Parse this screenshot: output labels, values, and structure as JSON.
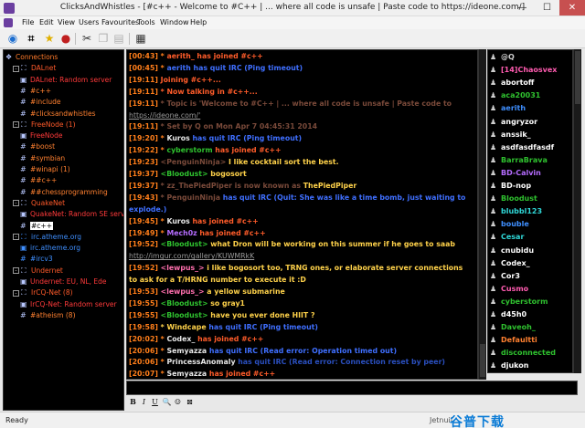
{
  "window": {
    "title": "ClicksAndWhistles - [#c++ - Welcome to #C++ | ... where all code is unsafe | Paste code to https://ideone.com/]",
    "controls": [
      "—",
      "☐",
      "✕"
    ]
  },
  "menu": [
    "File",
    "Edit",
    "View",
    "Users",
    "Favourites",
    "Tools",
    "Window",
    "Help"
  ],
  "toolbar_icons": [
    "globe-icon",
    "hash-icon",
    "star-icon",
    "ball-icon",
    "cut-icon",
    "copy-icon",
    "paste-icon",
    "clipboard-icon"
  ],
  "tree": [
    {
      "label": "Connections",
      "style": "t-conn",
      "indent": 0,
      "icon": "❖",
      "exp": null
    },
    {
      "label": "DALnet",
      "style": "t-net",
      "indent": 1,
      "icon": "⛶",
      "exp": "-"
    },
    {
      "label": "DALnet: Random server",
      "style": "t-server",
      "indent": 2,
      "icon": "▣",
      "exp": null
    },
    {
      "label": "#c++",
      "style": "t-chan",
      "indent": 2,
      "icon": "#",
      "exp": null
    },
    {
      "label": "#include",
      "style": "t-chan",
      "indent": 2,
      "icon": "#",
      "exp": null
    },
    {
      "label": "#clicksandwhistles",
      "style": "t-chan",
      "indent": 2,
      "icon": "#",
      "exp": null
    },
    {
      "label": "FreeNode (1)",
      "style": "t-net",
      "indent": 1,
      "icon": "⛶",
      "exp": "-"
    },
    {
      "label": "FreeNode",
      "style": "t-server",
      "indent": 2,
      "icon": "▣",
      "exp": null
    },
    {
      "label": "#boost",
      "style": "t-chan",
      "indent": 2,
      "icon": "#",
      "exp": null
    },
    {
      "label": "#symbian",
      "style": "t-chan",
      "indent": 2,
      "icon": "#",
      "exp": null
    },
    {
      "label": "#winapi (1)",
      "style": "t-chan",
      "indent": 2,
      "icon": "#",
      "exp": null
    },
    {
      "label": "##c++",
      "style": "t-chan",
      "indent": 2,
      "icon": "#",
      "exp": null
    },
    {
      "label": "##chessprogramming",
      "style": "t-chan",
      "indent": 2,
      "icon": "#",
      "exp": null
    },
    {
      "label": "QuakeNet",
      "style": "t-net",
      "indent": 1,
      "icon": "⛶",
      "exp": "-"
    },
    {
      "label": "QuakeNet: Random SE server",
      "style": "t-server",
      "indent": 2,
      "icon": "▣",
      "exp": null
    },
    {
      "label": "#c++",
      "style": "t-sel",
      "indent": 2,
      "icon": "#",
      "exp": null
    },
    {
      "label": "irc.atheme.org",
      "style": "t-blue",
      "indent": 1,
      "icon": "⛶",
      "exp": "-"
    },
    {
      "label": "irc.atheme.org",
      "style": "t-blue",
      "indent": 2,
      "icon": "▣",
      "exp": null
    },
    {
      "label": "#ircv3",
      "style": "t-blue",
      "indent": 2,
      "icon": "#",
      "exp": null
    },
    {
      "label": "Undernet",
      "style": "t-net",
      "indent": 1,
      "icon": "⛶",
      "exp": "-"
    },
    {
      "label": "Undernet: EU, NL, Ede",
      "style": "t-server",
      "indent": 2,
      "icon": "▣",
      "exp": null
    },
    {
      "label": "IrCQ-Net (8)",
      "style": "t-net",
      "indent": 1,
      "icon": "⛶",
      "exp": "-"
    },
    {
      "label": "IrCQ-Net: Random server",
      "style": "t-server",
      "indent": 2,
      "icon": "▣",
      "exp": null
    },
    {
      "label": "#atheism (8)",
      "style": "t-chan",
      "indent": 2,
      "icon": "#",
      "exp": null
    }
  ],
  "chat": [
    [
      {
        "t": "[00:43] ",
        "c": "c-time"
      },
      {
        "t": "* ",
        "c": "c-star"
      },
      {
        "t": "aerith_ has joined #c++",
        "c": "c-join"
      }
    ],
    [
      {
        "t": "[00:45] ",
        "c": "c-time"
      },
      {
        "t": "* ",
        "c": "c-star"
      },
      {
        "t": "aerith has quit IRC (Ping timeout)",
        "c": "c-part"
      }
    ],
    [
      {
        "t": "[19:11] ",
        "c": "c-time"
      },
      {
        "t": "Joining #c++...",
        "c": "c-join"
      }
    ],
    [
      {
        "t": "[19:11] ",
        "c": "c-time"
      },
      {
        "t": "* Now talking in #c++...",
        "c": "c-join"
      }
    ],
    [
      {
        "t": "[19:11] ",
        "c": "c-time"
      },
      {
        "t": "* Topic is 'Welcome to #C++ | ... where all code is unsafe | Paste code to",
        "c": "c-topicdim"
      }
    ],
    [
      {
        "t": "https://ideone.com/'",
        "c": "c-url"
      }
    ],
    [
      {
        "t": "[19:11] ",
        "c": "c-time"
      },
      {
        "t": "* Set by Q on Mon Apr 7 04:45:31 2014",
        "c": "c-topicdim"
      }
    ],
    [
      {
        "t": "[19:20] ",
        "c": "c-time"
      },
      {
        "t": "* ",
        "c": "c-star"
      },
      {
        "t": "Kuros ",
        "c": "c-white"
      },
      {
        "t": "has quit IRC (Ping timeout)",
        "c": "c-part"
      }
    ],
    [
      {
        "t": "[19:22] ",
        "c": "c-time"
      },
      {
        "t": "* ",
        "c": "c-star"
      },
      {
        "t": "cyberstorm ",
        "c": "c-nick"
      },
      {
        "t": "has joined #c++",
        "c": "c-join"
      }
    ],
    [
      {
        "t": "[19:23] ",
        "c": "c-time"
      },
      {
        "t": "<PenguinNinja> ",
        "c": "c-topicdim"
      },
      {
        "t": "I like cocktail sort the best.",
        "c": "c-msg"
      }
    ],
    [
      {
        "t": "[19:37] ",
        "c": "c-time"
      },
      {
        "t": "<Bloodust> ",
        "c": "c-nick"
      },
      {
        "t": "bogosort",
        "c": "c-msg"
      }
    ],
    [
      {
        "t": "[19:37] ",
        "c": "c-time"
      },
      {
        "t": "* zz_ThePiedPiper is now known as ",
        "c": "c-topicdim"
      },
      {
        "t": "ThePiedPiper",
        "c": "c-msg"
      }
    ],
    [
      {
        "t": "[19:43] ",
        "c": "c-time"
      },
      {
        "t": "* PenguinNinja ",
        "c": "c-topicdim"
      },
      {
        "t": "has quit IRC (Quit: She was like a time bomb, just waiting to",
        "c": "c-part"
      }
    ],
    [
      {
        "t": "explode.)",
        "c": "c-part"
      }
    ],
    [
      {
        "t": "[19:45] ",
        "c": "c-time"
      },
      {
        "t": "* ",
        "c": "c-star"
      },
      {
        "t": "Kuros ",
        "c": "c-white"
      },
      {
        "t": "has joined #c++",
        "c": "c-join"
      }
    ],
    [
      {
        "t": "[19:49] ",
        "c": "c-time"
      },
      {
        "t": "* ",
        "c": "c-star"
      },
      {
        "t": "Mech0z ",
        "c": "c-purple"
      },
      {
        "t": "has joined #c++",
        "c": "c-join"
      }
    ],
    [
      {
        "t": "[19:52] ",
        "c": "c-time"
      },
      {
        "t": "<Bloodust> ",
        "c": "c-nick"
      },
      {
        "t": "what Dron will be working on this summer if he goes to saab",
        "c": "c-msg"
      }
    ],
    [
      {
        "t": "http://imgur.com/gallery/KUWMRkK",
        "c": "c-url"
      }
    ],
    [
      {
        "t": "[19:52] ",
        "c": "c-time"
      },
      {
        "t": "<lewpus_> ",
        "c": "c-rose"
      },
      {
        "t": "i like bogosort too, TRNG ones, or elaborate server connections",
        "c": "c-msg"
      }
    ],
    [
      {
        "t": "to ask for a T/HRNG number to execute it :D",
        "c": "c-msg"
      }
    ],
    [
      {
        "t": "[19:53] ",
        "c": "c-time"
      },
      {
        "t": "<lewpus_> ",
        "c": "c-rose"
      },
      {
        "t": "a yellow submarine",
        "c": "c-msg"
      }
    ],
    [
      {
        "t": "[19:55] ",
        "c": "c-time"
      },
      {
        "t": "<Bloodust> ",
        "c": "c-nick"
      },
      {
        "t": "so gray1",
        "c": "c-msg"
      }
    ],
    [
      {
        "t": "[19:55] ",
        "c": "c-time"
      },
      {
        "t": "<Bloodust> ",
        "c": "c-nick"
      },
      {
        "t": "have you ever done HIIT ?",
        "c": "c-msg"
      }
    ],
    [
      {
        "t": "[19:58] ",
        "c": "c-time"
      },
      {
        "t": "* Windcape ",
        "c": "c-msg"
      },
      {
        "t": "has quit IRC (Ping timeout)",
        "c": "c-part"
      }
    ],
    [
      {
        "t": "[20:02] ",
        "c": "c-time"
      },
      {
        "t": "* ",
        "c": "c-star"
      },
      {
        "t": "Codex_ ",
        "c": "c-white"
      },
      {
        "t": "has joined #c++",
        "c": "c-join"
      }
    ],
    [
      {
        "t": "[20:06] ",
        "c": "c-time"
      },
      {
        "t": "* ",
        "c": "c-star"
      },
      {
        "t": "Semyazza ",
        "c": "c-white"
      },
      {
        "t": "has quit IRC (Read error: Operation timed out)",
        "c": "c-part"
      }
    ],
    [
      {
        "t": "[20:06] ",
        "c": "c-time"
      },
      {
        "t": "* ",
        "c": "c-star"
      },
      {
        "t": "PrincessAnomaly ",
        "c": "c-white"
      },
      {
        "t": "has quit IRC (Read error: Connection reset by peer)",
        "c": "c-quit-dim"
      }
    ],
    [
      {
        "t": "[20:07] ",
        "c": "c-time"
      },
      {
        "t": "* ",
        "c": "c-star"
      },
      {
        "t": "Semyazza ",
        "c": "c-white"
      },
      {
        "t": "has joined #c++",
        "c": "c-join"
      }
    ]
  ],
  "nicks": [
    {
      "name": "@Q",
      "color": "#cfcfcf"
    },
    {
      "name": "[14]Chaosvex",
      "color": "#ff5bb0"
    },
    {
      "name": "abortoff",
      "color": "#ffffff"
    },
    {
      "name": "aca20031",
      "color": "#2fc22f"
    },
    {
      "name": "aerith",
      "color": "#3f8fff"
    },
    {
      "name": "angryzor",
      "color": "#ffffff"
    },
    {
      "name": "anssik_",
      "color": "#ffffff"
    },
    {
      "name": "asdfasdfasdf",
      "color": "#ffffff"
    },
    {
      "name": "BarraBrava",
      "color": "#2fc22f"
    },
    {
      "name": "BD-Calvin",
      "color": "#b56cff"
    },
    {
      "name": "BD-nop",
      "color": "#ffffff"
    },
    {
      "name": "Bloodust",
      "color": "#2fc22f"
    },
    {
      "name": "blubbl123",
      "color": "#2fd7d7"
    },
    {
      "name": "bouble",
      "color": "#3f8fff"
    },
    {
      "name": "Cesar",
      "color": "#2fd7d7"
    },
    {
      "name": "cnubidu",
      "color": "#ffffff"
    },
    {
      "name": "Codex_",
      "color": "#ffffff"
    },
    {
      "name": "Cor3",
      "color": "#ffffff"
    },
    {
      "name": "Cusmo",
      "color": "#ff5bb0"
    },
    {
      "name": "cyberstorm",
      "color": "#2fc22f"
    },
    {
      "name": "d45h0",
      "color": "#ffffff"
    },
    {
      "name": "Daveoh_",
      "color": "#2fc22f"
    },
    {
      "name": "Defaultti",
      "color": "#ff8030"
    },
    {
      "name": "disconnected",
      "color": "#2fc22f"
    },
    {
      "name": "djukon",
      "color": "#ffffff"
    }
  ],
  "format_buttons": [
    "B",
    "I",
    "U",
    "🔍",
    "☺",
    "⊠"
  ],
  "status": {
    "text": "Ready",
    "center": "Jetnuii"
  },
  "watermark": "谷普下载"
}
